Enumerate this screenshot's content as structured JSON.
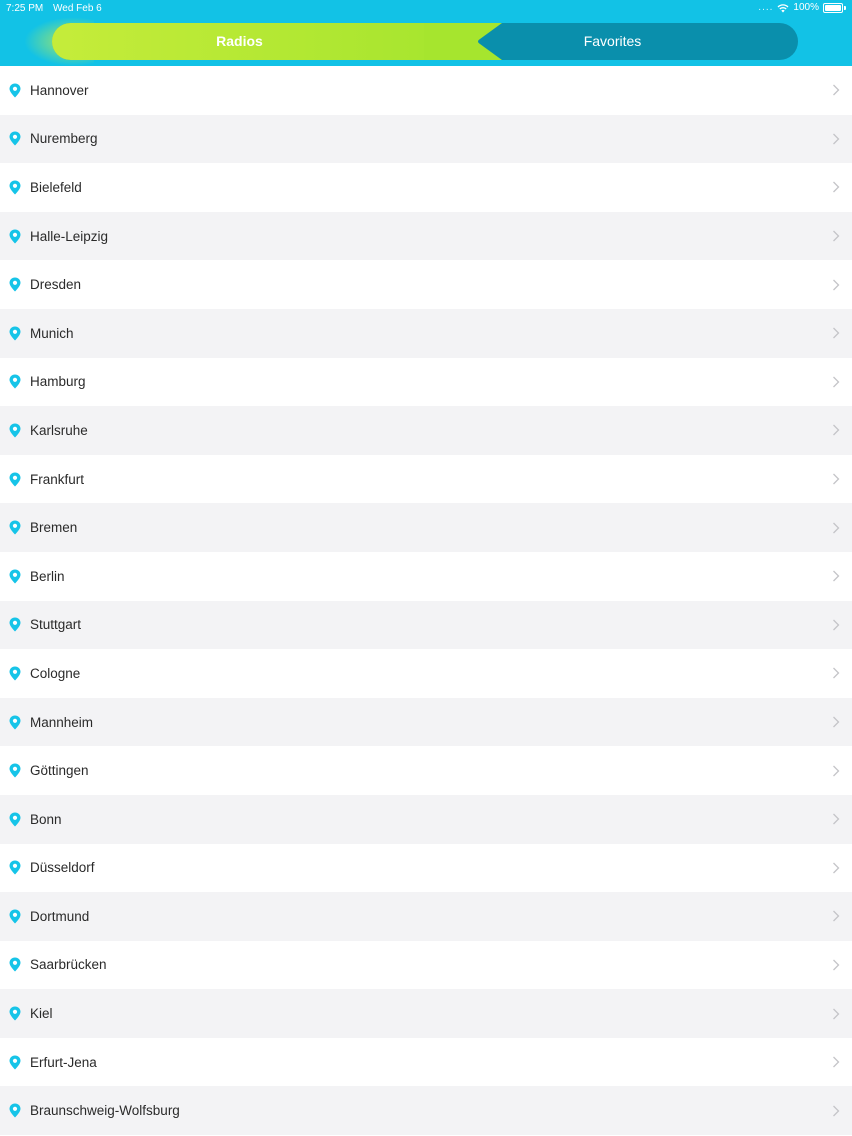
{
  "status": {
    "time": "7:25 PM",
    "date": "Wed Feb 6",
    "signal": "....",
    "battery": "100%"
  },
  "tabs": {
    "radios_label": "Radios",
    "favorites_label": "Favorites",
    "selected": "Radios"
  },
  "colors": {
    "header": "#12c2e6",
    "accent_green": "#a6e52e",
    "pin": "#16c4e8"
  },
  "cities": [
    {
      "label": "Hannover"
    },
    {
      "label": "Nuremberg"
    },
    {
      "label": "Bielefeld"
    },
    {
      "label": "Halle-Leipzig"
    },
    {
      "label": "Dresden"
    },
    {
      "label": "Munich"
    },
    {
      "label": "Hamburg"
    },
    {
      "label": "Karlsruhe"
    },
    {
      "label": "Frankfurt"
    },
    {
      "label": "Bremen"
    },
    {
      "label": "Berlin"
    },
    {
      "label": "Stuttgart"
    },
    {
      "label": "Cologne"
    },
    {
      "label": "Mannheim"
    },
    {
      "label": "Göttingen"
    },
    {
      "label": "Bonn"
    },
    {
      "label": "Düsseldorf"
    },
    {
      "label": "Dortmund"
    },
    {
      "label": "Saarbrücken"
    },
    {
      "label": "Kiel"
    },
    {
      "label": "Erfurt-Jena"
    },
    {
      "label": "Braunschweig-Wolfsburg"
    }
  ]
}
